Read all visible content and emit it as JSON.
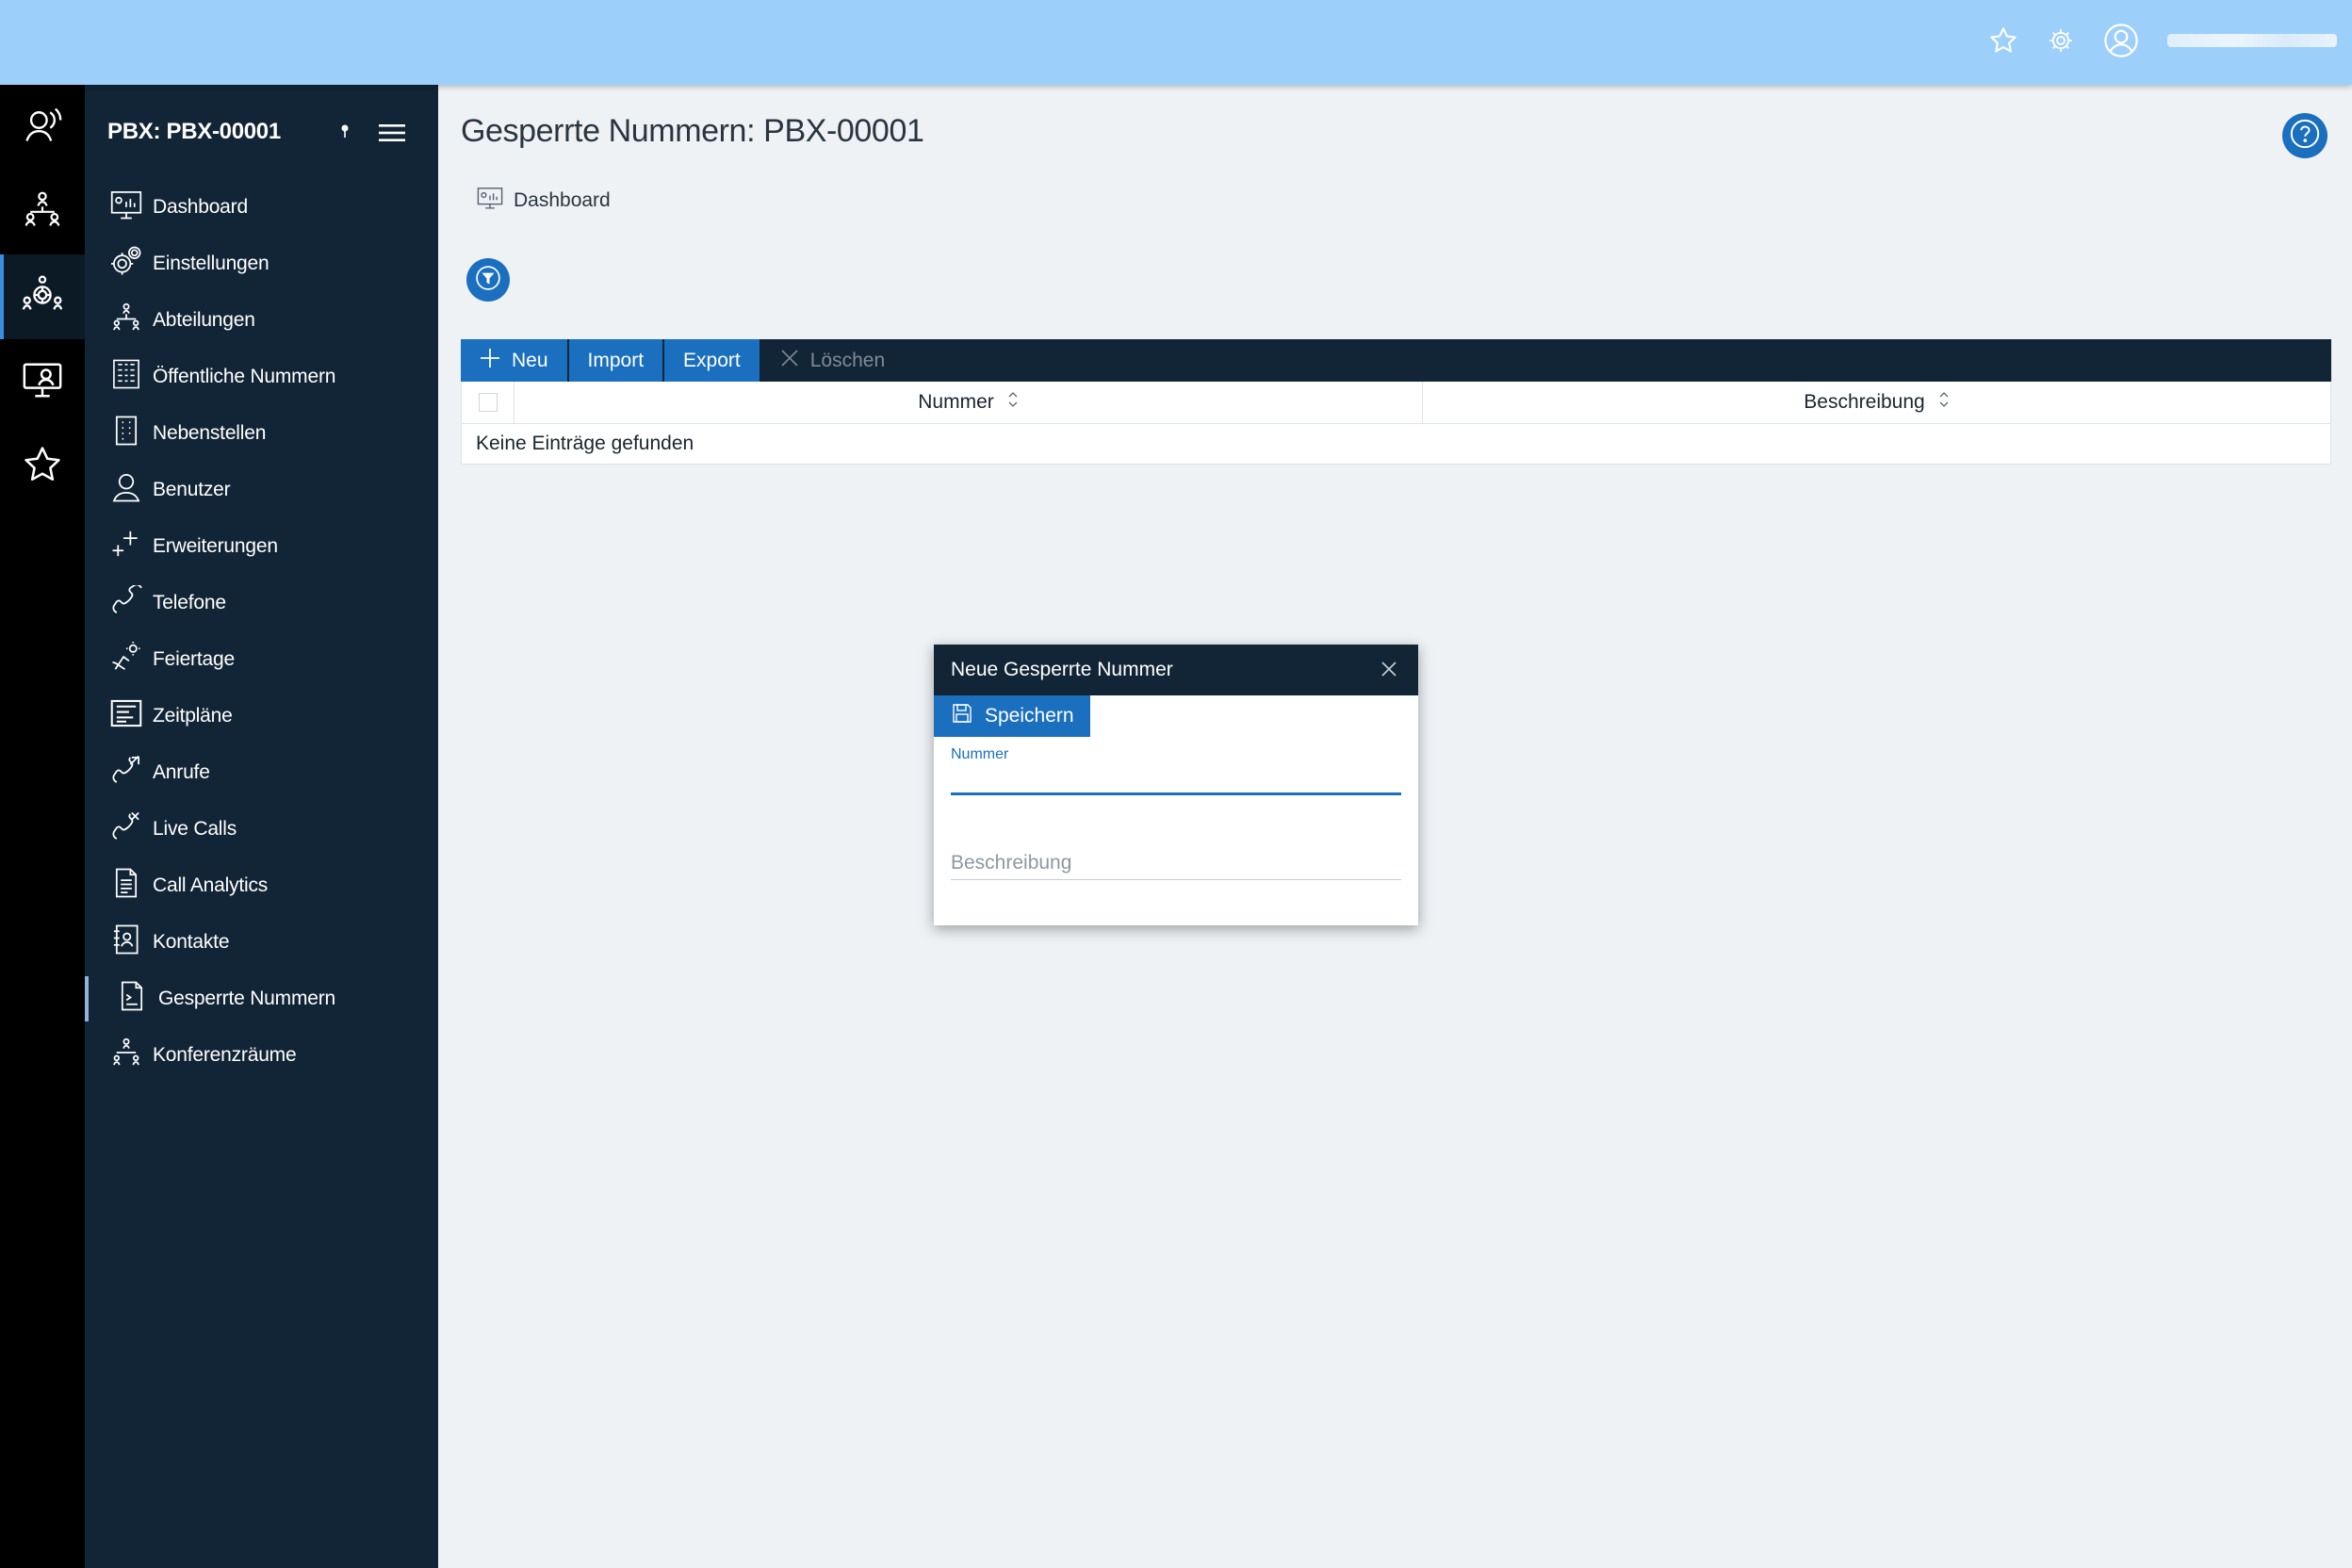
{
  "topbar": {
    "icons": [
      "star-icon",
      "gear-icon",
      "user-icon"
    ],
    "user_name_redacted": true
  },
  "rail": {
    "items": [
      {
        "icon": "headset-user-icon"
      },
      {
        "icon": "org-chart-icon"
      },
      {
        "icon": "group-settings-icon",
        "active": true
      },
      {
        "icon": "monitor-user-icon"
      },
      {
        "icon": "star-icon"
      }
    ]
  },
  "sidebar": {
    "title": "PBX: PBX-00001",
    "items": [
      {
        "label": "Dashboard",
        "icon": "dashboard-icon"
      },
      {
        "label": "Einstellungen",
        "icon": "gears-icon"
      },
      {
        "label": "Abteilungen",
        "icon": "org-chart-icon"
      },
      {
        "label": "Öffentliche Nummern",
        "icon": "keypad-grid-icon"
      },
      {
        "label": "Nebenstellen",
        "icon": "extension-icon"
      },
      {
        "label": "Benutzer",
        "icon": "user-icon"
      },
      {
        "label": "Erweiterungen",
        "icon": "plus-extensions-icon"
      },
      {
        "label": "Telefone",
        "icon": "phone-icon"
      },
      {
        "label": "Feiertage",
        "icon": "holiday-icon"
      },
      {
        "label": "Zeitpläne",
        "icon": "schedule-icon"
      },
      {
        "label": "Anrufe",
        "icon": "calls-icon"
      },
      {
        "label": "Live Calls",
        "icon": "live-calls-icon"
      },
      {
        "label": "Call Analytics",
        "icon": "analytics-document-icon"
      },
      {
        "label": "Kontakte",
        "icon": "contacts-book-icon"
      },
      {
        "label": "Gesperrte Nummern",
        "icon": "blocked-document-icon",
        "active": true
      },
      {
        "label": "Konferenzräume",
        "icon": "conference-icon"
      }
    ]
  },
  "main": {
    "title": "Gesperrte Nummern: PBX-00001",
    "breadcrumb": "Dashboard",
    "toolbar": {
      "new": "Neu",
      "import": "Import",
      "export": "Export",
      "delete": "Löschen"
    },
    "grid": {
      "columns": [
        "Nummer",
        "Beschreibung"
      ],
      "empty_text": "Keine Einträge gefunden"
    }
  },
  "modal": {
    "title": "Neue Gesperrte Nummer",
    "save_label": "Speichern",
    "field_number_label": "Nummer",
    "field_number_value": "",
    "field_description_placeholder": "Beschreibung",
    "field_description_value": ""
  },
  "colors": {
    "topbar": "#9dcffb",
    "sidebar": "#122536",
    "rail": "#000000",
    "accent": "#1a6fbf",
    "background": "#eef2f5"
  }
}
